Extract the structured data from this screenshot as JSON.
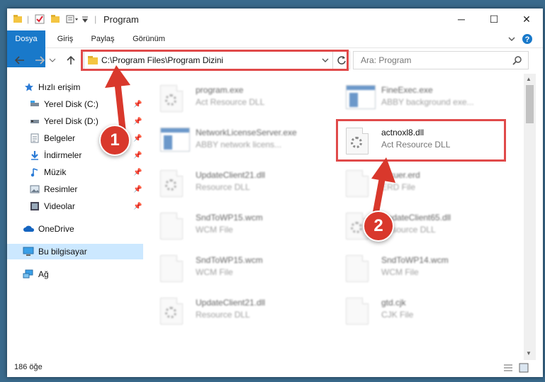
{
  "window": {
    "title": "Program",
    "controls": {
      "minimize": "─",
      "maximize": "☐",
      "close": "✕"
    }
  },
  "ribbon": {
    "tabs": [
      "Dosya",
      "Giriş",
      "Paylaş",
      "Görünüm"
    ]
  },
  "nav": {
    "address": "C:\\Program Files\\Program Dizini",
    "search_placeholder": "Ara: Program"
  },
  "sidebar": {
    "items": [
      {
        "label": "Hızlı erişim",
        "icon": "star-icon"
      },
      {
        "label": "Yerel Disk (C:)",
        "icon": "drive-icon"
      },
      {
        "label": "Yerel Disk (D:)",
        "icon": "drive-icon"
      },
      {
        "label": "Belgeler",
        "icon": "documents-icon"
      },
      {
        "label": "İndirmeler",
        "icon": "download-icon"
      },
      {
        "label": "Müzik",
        "icon": "music-icon"
      },
      {
        "label": "Resimler",
        "icon": "pictures-icon"
      },
      {
        "label": "Videolar",
        "icon": "video-icon"
      },
      {
        "label": "OneDrive",
        "icon": "cloud-icon"
      },
      {
        "label": "Bu bilgisayar",
        "icon": "computer-icon"
      },
      {
        "label": "Ağ",
        "icon": "network-icon"
      }
    ]
  },
  "files": [
    {
      "name": "program.exe",
      "type": "Act Resource DLL"
    },
    {
      "name": "FineExec.exe",
      "type": "ABBY background exe..."
    },
    {
      "name": "NetworkLicenseServer.exe",
      "type": "ABBY network licens..."
    },
    {
      "name": "actnoxl8.dll",
      "type": "Act Resource DLL"
    },
    {
      "name": "UpdateClient21.dll",
      "type": "Resource DLL"
    },
    {
      "name": "Atcuer.erd",
      "type": "ERD File"
    },
    {
      "name": "SndToWP15.wcm",
      "type": "WCM File"
    },
    {
      "name": "UpdateClient65.dll",
      "type": "Resource DLL"
    },
    {
      "name": "SndToWP15.wcm",
      "type": "WCM File"
    },
    {
      "name": "SndToWP14.wcm",
      "type": "WCM File"
    },
    {
      "name": "UpdateClient21.dll",
      "type": "Resource DLL"
    },
    {
      "name": "gtd.cjk",
      "type": "CJK File"
    }
  ],
  "status": {
    "item_count": "186 öğe"
  },
  "callouts": [
    "1",
    "2"
  ],
  "colors": {
    "accent": "#1979ca",
    "highlight": "#e04a4a",
    "callout": "#d9382c"
  }
}
